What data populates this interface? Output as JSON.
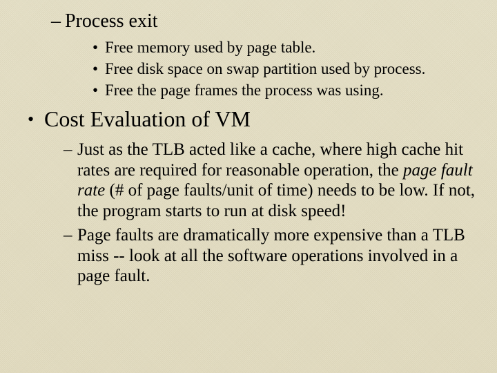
{
  "glyphs": {
    "big_bullet": "•",
    "small_bullet": "•",
    "dash": "–"
  },
  "top_dash": {
    "title": "Process exit",
    "subs": [
      "Free memory used by page table.",
      "Free disk space on swap partition used by process.",
      "Free the page frames the process was using."
    ]
  },
  "major": {
    "heading": "Cost Evaluation of VM",
    "items": [
      {
        "pre": "Just as the TLB acted like a cache, where high cache hit rates are required for reasonable operation, the ",
        "em": "page fault rate",
        "post": " (# of page faults/unit of time) needs to be low.  If not, the program starts to run at disk speed!"
      },
      {
        "pre": "Page faults are dramatically more expensive than a TLB miss -- look at all the software operations involved in a page fault.",
        "em": "",
        "post": ""
      }
    ]
  }
}
